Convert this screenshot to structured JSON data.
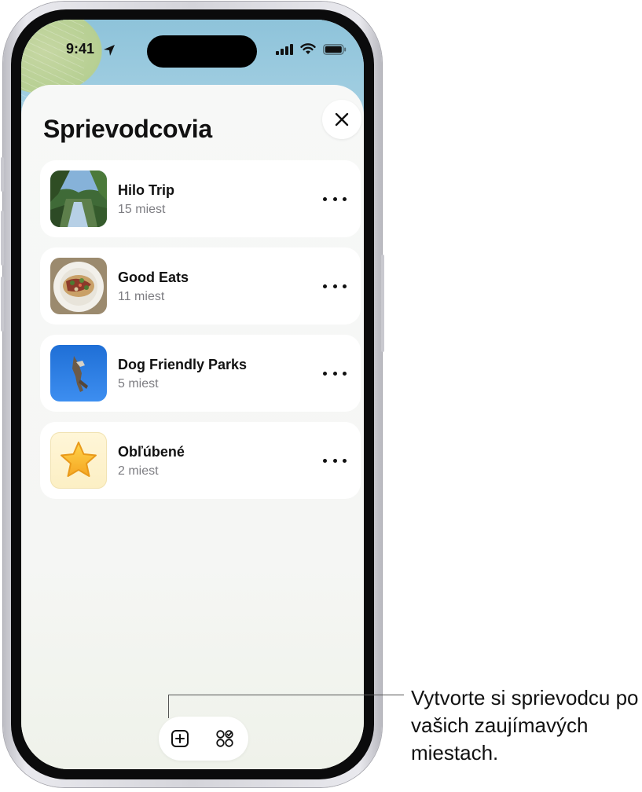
{
  "status_bar": {
    "time": "9:41"
  },
  "sheet": {
    "title": "Sprievodcovia",
    "guides": [
      {
        "name": "Hilo Trip",
        "count": "15 miest",
        "thumb": "waterfall-photo"
      },
      {
        "name": "Good Eats",
        "count": "11 miest",
        "thumb": "food-plate-photo"
      },
      {
        "name": "Dog Friendly Parks",
        "count": "5 miest",
        "thumb": "dog-jumping-photo"
      },
      {
        "name": "Obľúbené",
        "count": "2 miest",
        "thumb": "star-icon"
      }
    ]
  },
  "toolbar": {
    "new_guide_icon": "plus-square-icon",
    "collections_icon": "grid-circles-icon"
  },
  "callout": {
    "text": "Vytvorte si sprievodcu po vašich zaujímavých miestach."
  },
  "colors": {
    "accent": "#111111",
    "secondary_text": "#7d7d82",
    "sheet_bg": "#f5f6f4"
  }
}
